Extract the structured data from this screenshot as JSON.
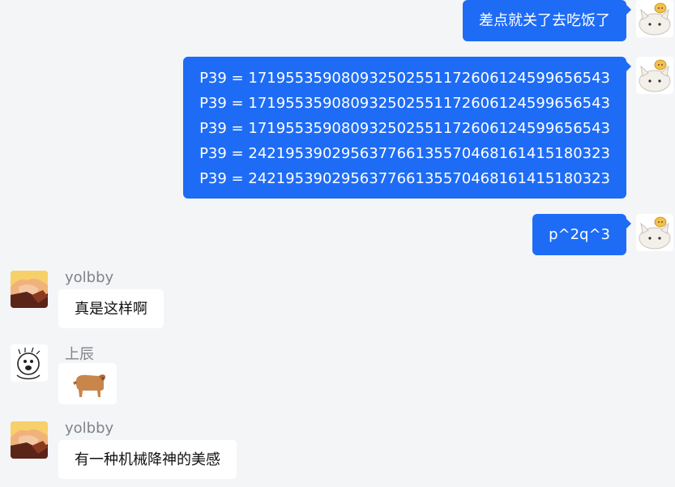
{
  "messages": {
    "out_1": {
      "text": "差点就关了去吃饭了"
    },
    "out_2": {
      "lines": [
        "P39 = 17195535908093250255117260612459965​6543",
        "P39 = 171955359080932502551172606124599656543",
        "P39 = 171955359080932502551172606124599656543",
        "P39 = 242195390295637766135570468161415180323",
        "P39 = 242195390295637766135570468161415180323"
      ]
    },
    "out_3": {
      "text": "p^2q^3"
    },
    "in_1": {
      "sender": "yolbby",
      "text": "真是这样啊"
    },
    "in_2": {
      "sender": "上辰",
      "sticker": "cow-sticker-icon"
    },
    "in_3": {
      "sender": "yolbby",
      "text": "有一种机械降神的美感"
    }
  },
  "icons": {
    "my_avatar": "cat-avatar-icon",
    "yolbby_avatar": "anime-avatar-icon",
    "shangchen_avatar": "doodle-avatar-icon"
  },
  "colors": {
    "out_bubble": "#1e6cf6",
    "in_bubble": "#ffffff",
    "background": "#f4f5f7",
    "sender_name": "#808389"
  }
}
